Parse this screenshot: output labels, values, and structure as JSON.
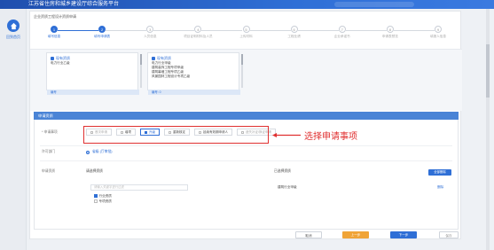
{
  "header": {
    "title": "江苏省住房和城乡建设厅综合服务平台"
  },
  "sidebar": {
    "home_label": "回到首页"
  },
  "breadcrumb": "企业资质工程设计资质申请",
  "steps": [
    {
      "num": "1",
      "label": "填写信息",
      "active": true
    },
    {
      "num": "2",
      "label": "填写申请表",
      "active": true
    },
    {
      "num": "3",
      "label": "人员信息",
      "active": false
    },
    {
      "num": "4",
      "label": "项目证明材料及人员",
      "active": false
    },
    {
      "num": "5",
      "label": "上传材料",
      "active": false
    },
    {
      "num": "6",
      "label": "工程业绩",
      "active": false
    },
    {
      "num": "7",
      "label": "企业承诺书",
      "active": false
    },
    {
      "num": "8",
      "label": "申请表预览",
      "active": false
    },
    {
      "num": "9",
      "label": "填报人信息",
      "active": false
    }
  ],
  "cards": [
    {
      "header": "现有资质",
      "items": [
        "电力行业乙级"
      ],
      "footer": "编号"
    },
    {
      "header": "现有资质",
      "items": [
        "电力行业甲级",
        "建筑装饰工程专项甲级",
        "建筑幕墙工程专项乙级",
        "风景园林工程设计专项乙级"
      ],
      "footer": "编号: 0"
    }
  ],
  "form": {
    "section_title": "申请资质",
    "apply_label": "* 申请事项",
    "options": [
      {
        "label": "首次申请",
        "state": "off"
      },
      {
        "label": "增项",
        "state": "dark"
      },
      {
        "label": "升级",
        "state": "on"
      },
      {
        "label": "重新核定",
        "state": "dark"
      },
      {
        "label": "延续有效期申请人",
        "state": "dark"
      },
      {
        "label": "遗失补证/换证申请",
        "state": "off"
      }
    ],
    "callout": "选择申请事项",
    "dept_label": "许可部门",
    "dept_value": "省级 (厅审批)",
    "qual_label": "申请资质",
    "pick_title": "请选择资质",
    "pick_search_placeholder": "请输入关键字进行过滤",
    "tree": [
      {
        "label": "行业资质",
        "checked": true
      },
      {
        "label": "专项资质",
        "checked": false
      }
    ],
    "selected_title": "已选择资质",
    "add_all": "全部删除",
    "selected_items": [
      {
        "label": "建筑行业甲级",
        "action": "删除"
      }
    ]
  },
  "footer": {
    "cancel": "取消",
    "prev": "上一步",
    "next": "下一步",
    "save": "保存"
  }
}
